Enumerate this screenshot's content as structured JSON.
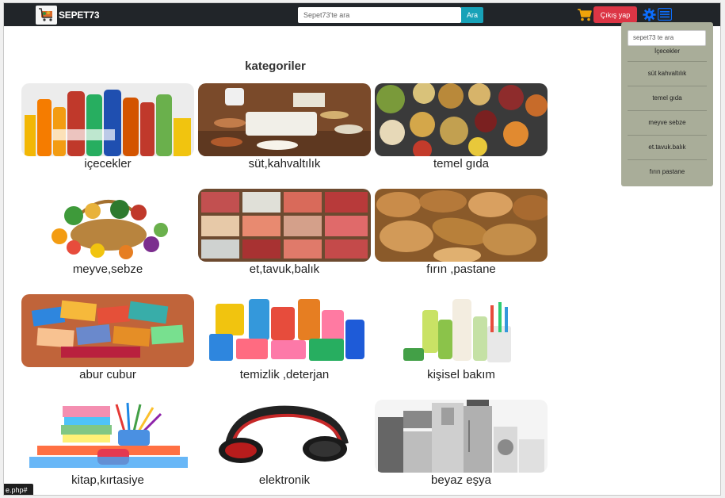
{
  "navbar": {
    "brand": "SEPET73",
    "search": {
      "placeholder": "Sepet73'te ara",
      "button_label": "Ara"
    },
    "logout_label": "Çıkış yap",
    "icons": [
      "cart-icon",
      "gear-icon",
      "menu-icon"
    ]
  },
  "main": {
    "title": "kategoriler",
    "categories": [
      {
        "label": "içecekler",
        "image": "drinks"
      },
      {
        "label": "süt,kahvaltılık",
        "image": "breakfast"
      },
      {
        "label": "temel gıda",
        "image": "grains-spices"
      },
      {
        "label": "meyve,sebze",
        "image": "fruit-basket"
      },
      {
        "label": "et,tavuk,balık",
        "image": "meat-fish"
      },
      {
        "label": "fırın ,pastane",
        "image": "bread"
      },
      {
        "label": "abur cubur",
        "image": "snacks"
      },
      {
        "label": "temizlik ,deterjan",
        "image": "detergents"
      },
      {
        "label": "kişisel bakım",
        "image": "personal-care"
      },
      {
        "label": "kitap,kırtasiye",
        "image": "stationery"
      },
      {
        "label": "elektronik",
        "image": "headphones"
      },
      {
        "label": "beyaz eşya",
        "image": "appliances"
      }
    ]
  },
  "dropdown": {
    "search_placeholder": "sepet73 te ara",
    "items": [
      "İçecekler",
      "süt kahvaltılık",
      "temel gıda",
      "meyve sebze",
      "et.tavuk.balık",
      "fırın pastane"
    ]
  },
  "status_bar": {
    "url": "e.php#"
  },
  "colors": {
    "navbar": "#212529",
    "search_button": "#17a2b8",
    "logout_button": "#dc3545",
    "cart": "#f0a30a",
    "settings": "#0d6efd",
    "dropdown_bg": "#a9ad99"
  }
}
